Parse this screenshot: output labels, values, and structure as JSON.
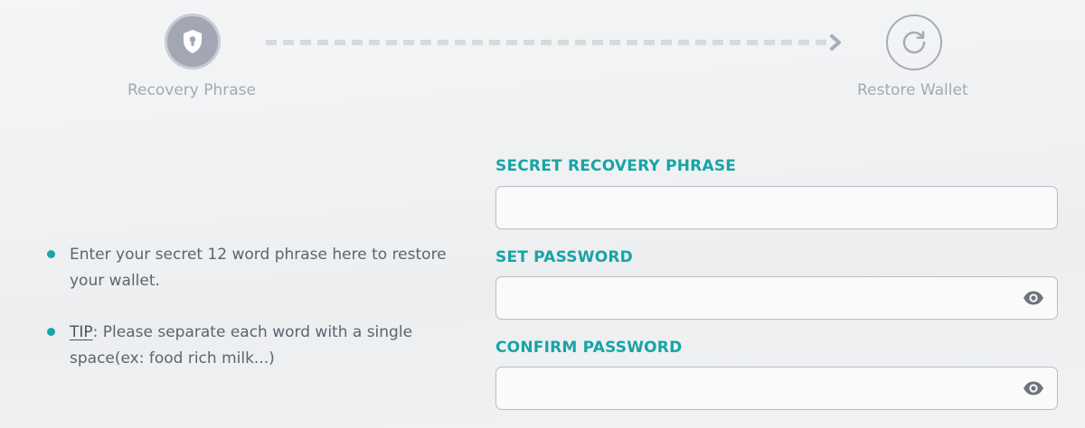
{
  "stepper": {
    "steps": [
      {
        "label": "Recovery Phrase",
        "icon": "shield-keyhole-icon",
        "state": "active"
      },
      {
        "label": "Restore Wallet",
        "icon": "refresh-icon",
        "state": "pending"
      }
    ]
  },
  "tips": {
    "items": [
      {
        "text": "Enter your secret 12 word phrase here to restore your wallet."
      },
      {
        "keyword": "TIP",
        "text": ": Please separate each word with a single space(ex: food rich milk...)"
      }
    ]
  },
  "form": {
    "recovery_phrase": {
      "label": "SECRET RECOVERY PHRASE",
      "value": ""
    },
    "password": {
      "label": "SET PASSWORD",
      "value": "",
      "icon": "eye-icon"
    },
    "confirm_password": {
      "label": "CONFIRM PASSWORD",
      "value": "",
      "icon": "eye-icon"
    }
  },
  "colors": {
    "accent": "#1aa6a6",
    "step_inactive": "#a3a7b3",
    "muted_text": "#a4a8b5",
    "body_text": "#5d6370"
  }
}
